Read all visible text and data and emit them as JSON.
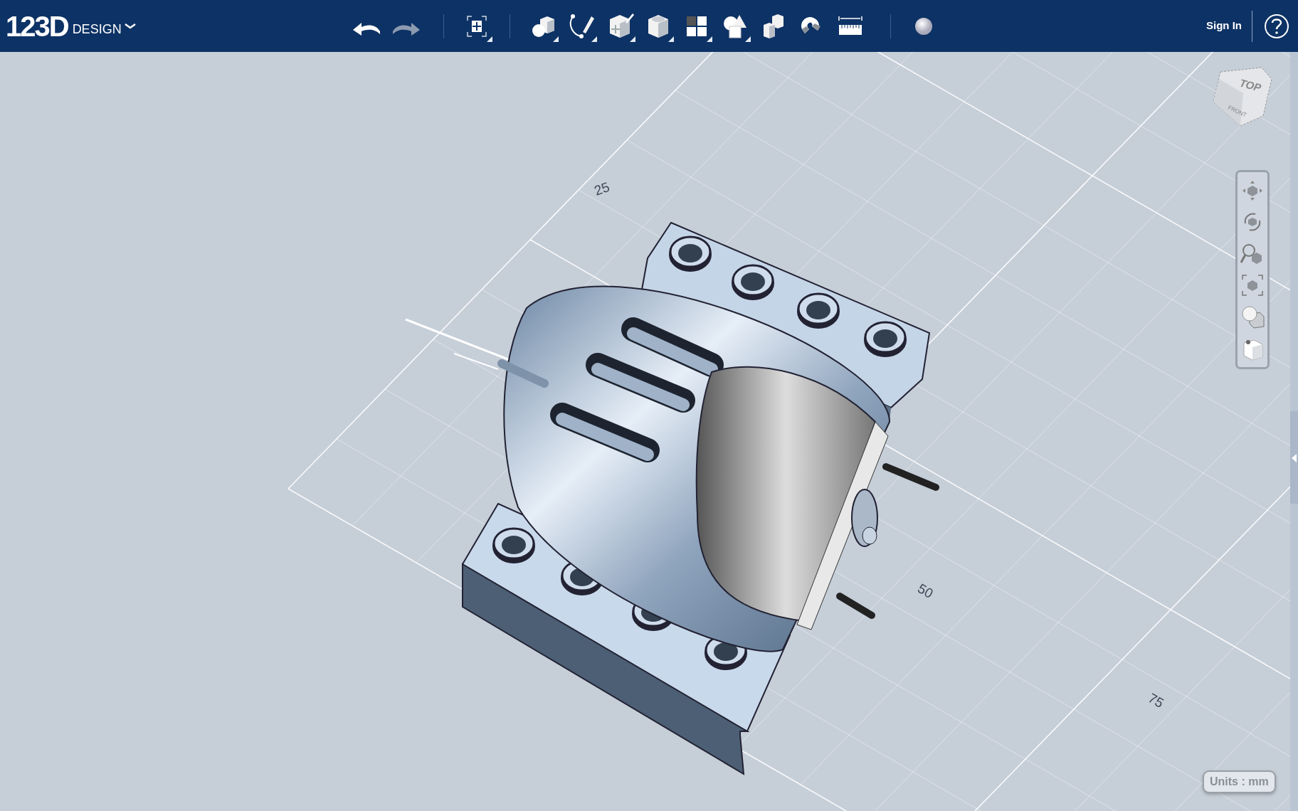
{
  "app_bar": {
    "logo": {
      "mark": "123D",
      "product": "DESIGN"
    },
    "sign_in": "Sign In"
  },
  "history": [
    {
      "kind": "undo",
      "disabled": false
    },
    {
      "kind": "redo",
      "disabled": true
    }
  ],
  "fit_tool": {
    "has_menu": true
  },
  "tools": [
    {
      "kind": "primitives",
      "has_menu": true
    },
    {
      "kind": "sketch",
      "has_menu": true
    },
    {
      "kind": "construct",
      "has_menu": true
    },
    {
      "kind": "modify",
      "has_menu": true
    },
    {
      "kind": "pattern",
      "has_menu": true
    },
    {
      "kind": "combine",
      "has_menu": true
    },
    {
      "kind": "group",
      "has_menu": false
    },
    {
      "kind": "snap",
      "has_menu": false
    },
    {
      "kind": "measure",
      "has_menu": false
    }
  ],
  "viewport": {
    "grid_labels": [
      "25",
      "50",
      "75"
    ],
    "view_cube": {
      "top": "TOP",
      "front": "FRONT"
    },
    "nav_tools": [
      {
        "kind": "pan"
      },
      {
        "kind": "orbit"
      },
      {
        "kind": "zoom"
      },
      {
        "kind": "fit"
      },
      {
        "kind": "view_mode"
      },
      {
        "kind": "visibility"
      }
    ],
    "units": "Units : mm"
  }
}
